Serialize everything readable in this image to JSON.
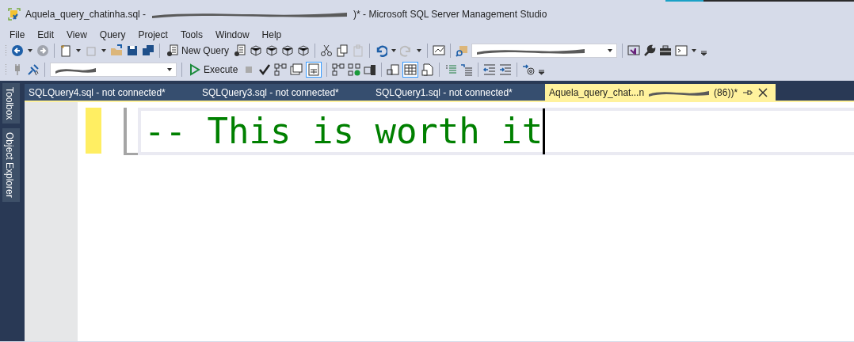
{
  "window": {
    "title_start": "Aquela_query_chatinha.sql -",
    "title_end": ")* - Microsoft SQL Server Management Studio"
  },
  "menu": [
    "File",
    "Edit",
    "View",
    "Query",
    "Project",
    "Tools",
    "Window",
    "Help"
  ],
  "toolbar": {
    "new_query": "New Query",
    "execute": "Execute"
  },
  "side_tabs": [
    "Toolbox",
    "Object Explorer"
  ],
  "tabs": [
    {
      "label": "SQLQuery4.sql - not connected*",
      "selected": false
    },
    {
      "label": "SQLQuery3.sql - not connected*",
      "selected": false
    },
    {
      "label": "SQLQuery1.sql - not connected*",
      "selected": false
    },
    {
      "label": "Aquela_query_chat...n",
      "label_end": "(86))*",
      "selected": true
    }
  ],
  "editor": {
    "line": "-- This is worth it"
  }
}
